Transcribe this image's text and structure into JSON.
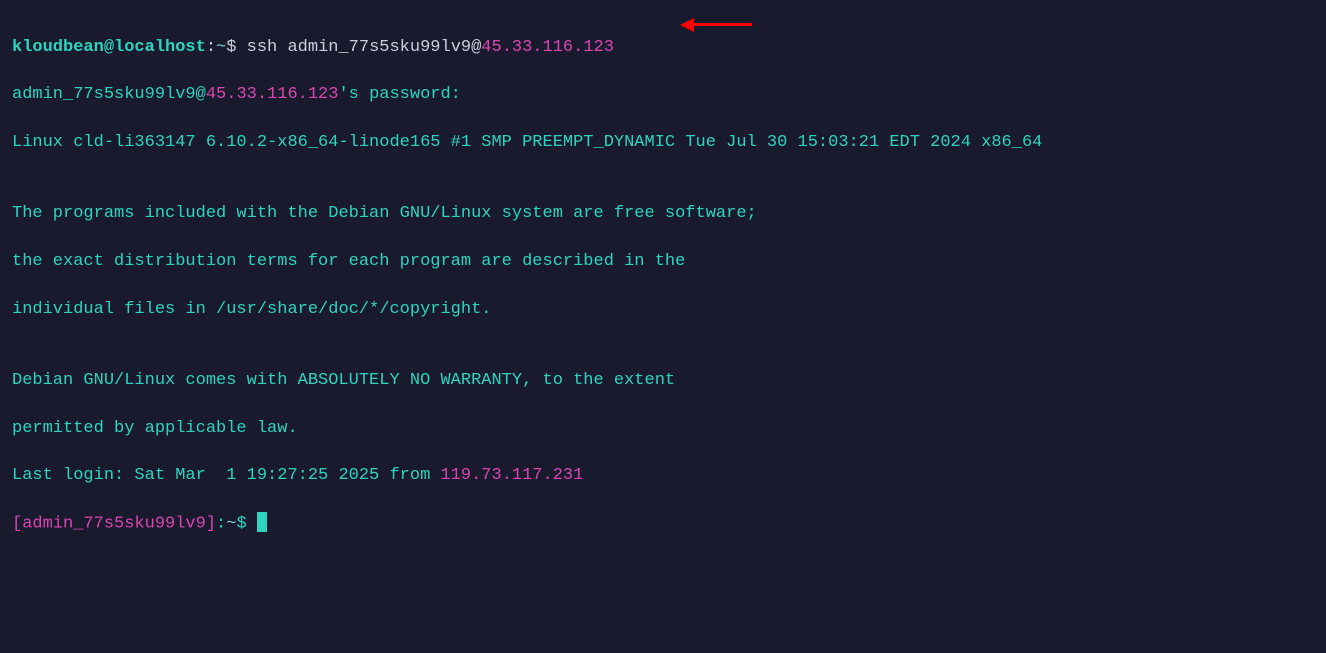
{
  "line1": {
    "userhost": "kloudbean@localhost",
    "colon": ":",
    "path": "~",
    "dollar": "$",
    "sshcmd": " ssh admin_77s5sku99lv9@",
    "ip": "45.33.116.123"
  },
  "line2": {
    "text1": "admin_77s5sku99lv9@",
    "ip": "45.33.116.123",
    "text2": "'s password:"
  },
  "line3": "Linux cld-li363147 6.10.2-x86_64-linode165 #1 SMP PREEMPT_DYNAMIC Tue Jul 30 15:03:21 EDT 2024 x86_64",
  "line4": "",
  "line5": "The programs included with the Debian GNU/Linux system are free software;",
  "line6": "the exact distribution terms for each program are described in the",
  "line7": "individual files in /usr/share/doc/*/copyright.",
  "line8": "",
  "line9": "Debian GNU/Linux comes with ABSOLUTELY NO WARRANTY, to the extent",
  "line10": "permitted by applicable law.",
  "line11": {
    "text1": "Last login: Sat Mar  1 19:27:25 2025 from ",
    "ip": "119.73.117.231"
  },
  "line12": {
    "bracket1": "[",
    "user": "admin_77s5sku99lv9",
    "bracket2": "]",
    "colon": ":",
    "path": "~",
    "dollar": "$ "
  }
}
